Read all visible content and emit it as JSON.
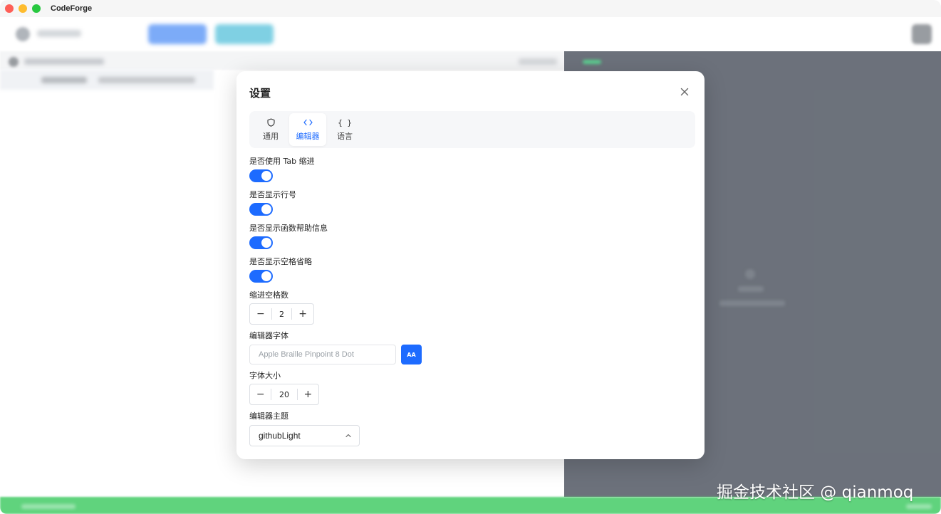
{
  "window": {
    "title": "CodeForge"
  },
  "settings_dialog": {
    "title": "设置",
    "tabs": [
      {
        "label": "通用",
        "icon": "shield-icon",
        "active": false
      },
      {
        "label": "编辑器",
        "icon": "code-icon",
        "active": true
      },
      {
        "label": "语言",
        "icon": "braces-icon",
        "active": false,
        "glyph": "{ }"
      }
    ],
    "editor": {
      "use_tab_indent": {
        "label": "是否使用 Tab 缩进",
        "value": true
      },
      "show_line_numbers": {
        "label": "是否显示行号",
        "value": true
      },
      "show_function_help": {
        "label": "是否显示函数帮助信息",
        "value": true
      },
      "show_whitespace": {
        "label": "是否显示空格省略",
        "value": true
      },
      "indent_spaces": {
        "label": "缩进空格数",
        "value": "2"
      },
      "font_family": {
        "label": "编辑器字体",
        "placeholder": "Apple Braille Pinpoint 8 Dot",
        "button_label": "AA"
      },
      "font_size": {
        "label": "字体大小",
        "value": "20"
      },
      "theme": {
        "label": "编辑器主题",
        "value": "githubLight"
      }
    },
    "stepper_minus": "−",
    "stepper_plus": "+"
  },
  "watermark": "掘金技术社区 @ qianmoq",
  "colors": {
    "accent": "#1d6bff",
    "status_bar": "#34c759",
    "dark_panel": "#434a56"
  }
}
